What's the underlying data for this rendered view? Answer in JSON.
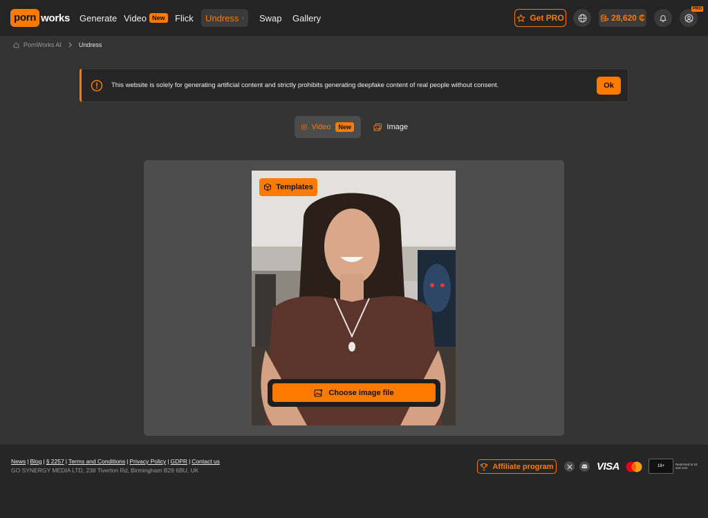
{
  "brand": {
    "part1": "porn",
    "part2": "works"
  },
  "nav": {
    "generate": "Generate",
    "video": "Video",
    "video_badge": "New",
    "flick": "Flick",
    "undress": "Undress",
    "swap": "Swap",
    "gallery": "Gallery"
  },
  "header": {
    "get_pro": "Get PRO",
    "credits": "28,620 ₵",
    "pro_tag": "PRO"
  },
  "breadcrumb": {
    "root": "PornWorks AI",
    "current": "Undress"
  },
  "notice": {
    "text": "This website is solely for generating artificial content and strictly prohibits generating deepfake content of real people without consent.",
    "ok": "Ok"
  },
  "tabs": {
    "video": "Video",
    "video_badge": "New",
    "image": "Image"
  },
  "editor": {
    "templates": "Templates",
    "choose": "Choose image file"
  },
  "footer": {
    "links": [
      "News",
      "Blog",
      "§ 2257",
      "Terms and Conditions",
      "Privacy Policy",
      "GDPR",
      "Contact us"
    ],
    "address": "GO SYNERGY MEDIA LTD, 238 Tiverton Rd, Birmingham B29 6BU, UK",
    "affiliate": "Affiliate program",
    "visa": "VISA",
    "rta_badge": "18+",
    "rta_note": "Restricted to 18 and over"
  },
  "colors": {
    "accent": "#ff7a00",
    "background": "#333333",
    "bar": "#242424"
  }
}
